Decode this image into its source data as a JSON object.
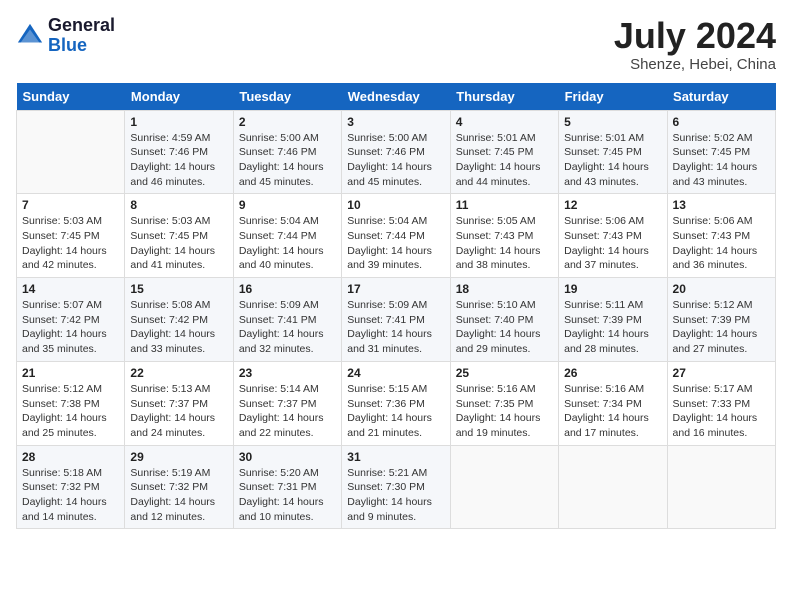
{
  "logo": {
    "general": "General",
    "blue": "Blue"
  },
  "title": "July 2024",
  "location": "Shenze, Hebei, China",
  "days_of_week": [
    "Sunday",
    "Monday",
    "Tuesday",
    "Wednesday",
    "Thursday",
    "Friday",
    "Saturday"
  ],
  "weeks": [
    [
      {
        "day": "",
        "info": ""
      },
      {
        "day": "1",
        "info": "Sunrise: 4:59 AM\nSunset: 7:46 PM\nDaylight: 14 hours\nand 46 minutes."
      },
      {
        "day": "2",
        "info": "Sunrise: 5:00 AM\nSunset: 7:46 PM\nDaylight: 14 hours\nand 45 minutes."
      },
      {
        "day": "3",
        "info": "Sunrise: 5:00 AM\nSunset: 7:46 PM\nDaylight: 14 hours\nand 45 minutes."
      },
      {
        "day": "4",
        "info": "Sunrise: 5:01 AM\nSunset: 7:45 PM\nDaylight: 14 hours\nand 44 minutes."
      },
      {
        "day": "5",
        "info": "Sunrise: 5:01 AM\nSunset: 7:45 PM\nDaylight: 14 hours\nand 43 minutes."
      },
      {
        "day": "6",
        "info": "Sunrise: 5:02 AM\nSunset: 7:45 PM\nDaylight: 14 hours\nand 43 minutes."
      }
    ],
    [
      {
        "day": "7",
        "info": "Sunrise: 5:03 AM\nSunset: 7:45 PM\nDaylight: 14 hours\nand 42 minutes."
      },
      {
        "day": "8",
        "info": "Sunrise: 5:03 AM\nSunset: 7:45 PM\nDaylight: 14 hours\nand 41 minutes."
      },
      {
        "day": "9",
        "info": "Sunrise: 5:04 AM\nSunset: 7:44 PM\nDaylight: 14 hours\nand 40 minutes."
      },
      {
        "day": "10",
        "info": "Sunrise: 5:04 AM\nSunset: 7:44 PM\nDaylight: 14 hours\nand 39 minutes."
      },
      {
        "day": "11",
        "info": "Sunrise: 5:05 AM\nSunset: 7:43 PM\nDaylight: 14 hours\nand 38 minutes."
      },
      {
        "day": "12",
        "info": "Sunrise: 5:06 AM\nSunset: 7:43 PM\nDaylight: 14 hours\nand 37 minutes."
      },
      {
        "day": "13",
        "info": "Sunrise: 5:06 AM\nSunset: 7:43 PM\nDaylight: 14 hours\nand 36 minutes."
      }
    ],
    [
      {
        "day": "14",
        "info": "Sunrise: 5:07 AM\nSunset: 7:42 PM\nDaylight: 14 hours\nand 35 minutes."
      },
      {
        "day": "15",
        "info": "Sunrise: 5:08 AM\nSunset: 7:42 PM\nDaylight: 14 hours\nand 33 minutes."
      },
      {
        "day": "16",
        "info": "Sunrise: 5:09 AM\nSunset: 7:41 PM\nDaylight: 14 hours\nand 32 minutes."
      },
      {
        "day": "17",
        "info": "Sunrise: 5:09 AM\nSunset: 7:41 PM\nDaylight: 14 hours\nand 31 minutes."
      },
      {
        "day": "18",
        "info": "Sunrise: 5:10 AM\nSunset: 7:40 PM\nDaylight: 14 hours\nand 29 minutes."
      },
      {
        "day": "19",
        "info": "Sunrise: 5:11 AM\nSunset: 7:39 PM\nDaylight: 14 hours\nand 28 minutes."
      },
      {
        "day": "20",
        "info": "Sunrise: 5:12 AM\nSunset: 7:39 PM\nDaylight: 14 hours\nand 27 minutes."
      }
    ],
    [
      {
        "day": "21",
        "info": "Sunrise: 5:12 AM\nSunset: 7:38 PM\nDaylight: 14 hours\nand 25 minutes."
      },
      {
        "day": "22",
        "info": "Sunrise: 5:13 AM\nSunset: 7:37 PM\nDaylight: 14 hours\nand 24 minutes."
      },
      {
        "day": "23",
        "info": "Sunrise: 5:14 AM\nSunset: 7:37 PM\nDaylight: 14 hours\nand 22 minutes."
      },
      {
        "day": "24",
        "info": "Sunrise: 5:15 AM\nSunset: 7:36 PM\nDaylight: 14 hours\nand 21 minutes."
      },
      {
        "day": "25",
        "info": "Sunrise: 5:16 AM\nSunset: 7:35 PM\nDaylight: 14 hours\nand 19 minutes."
      },
      {
        "day": "26",
        "info": "Sunrise: 5:16 AM\nSunset: 7:34 PM\nDaylight: 14 hours\nand 17 minutes."
      },
      {
        "day": "27",
        "info": "Sunrise: 5:17 AM\nSunset: 7:33 PM\nDaylight: 14 hours\nand 16 minutes."
      }
    ],
    [
      {
        "day": "28",
        "info": "Sunrise: 5:18 AM\nSunset: 7:32 PM\nDaylight: 14 hours\nand 14 minutes."
      },
      {
        "day": "29",
        "info": "Sunrise: 5:19 AM\nSunset: 7:32 PM\nDaylight: 14 hours\nand 12 minutes."
      },
      {
        "day": "30",
        "info": "Sunrise: 5:20 AM\nSunset: 7:31 PM\nDaylight: 14 hours\nand 10 minutes."
      },
      {
        "day": "31",
        "info": "Sunrise: 5:21 AM\nSunset: 7:30 PM\nDaylight: 14 hours\nand 9 minutes."
      },
      {
        "day": "",
        "info": ""
      },
      {
        "day": "",
        "info": ""
      },
      {
        "day": "",
        "info": ""
      }
    ]
  ]
}
